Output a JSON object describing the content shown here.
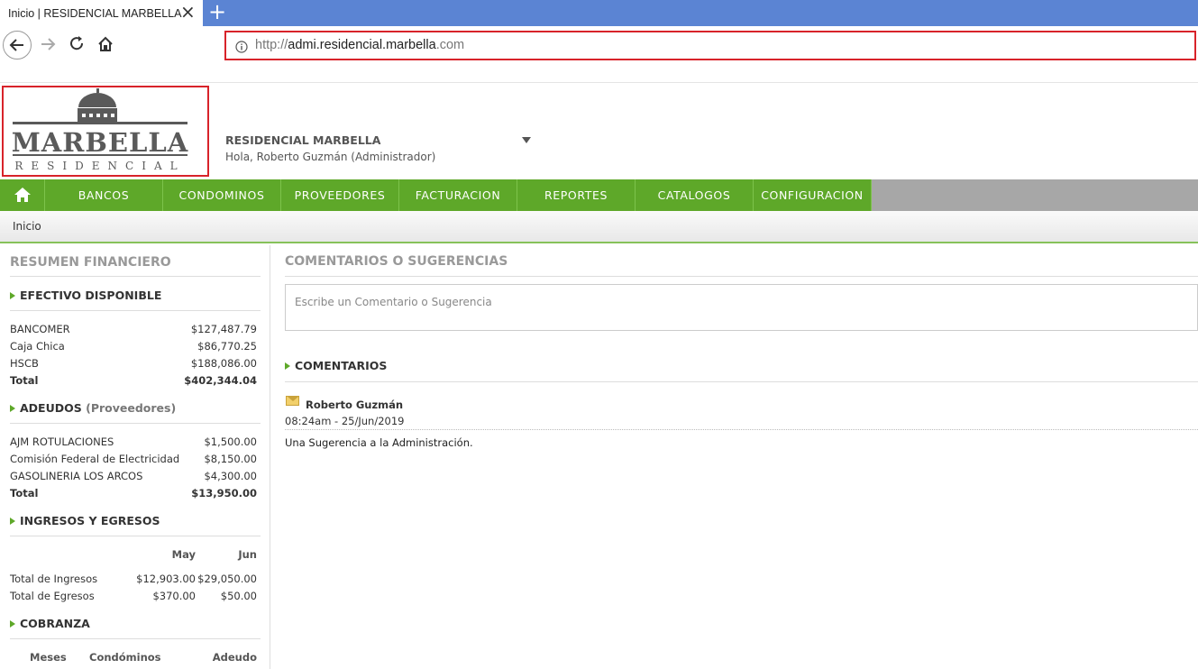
{
  "browser": {
    "tab_title": "Inicio | RESIDENCIAL MARBELLA",
    "close_glyph": "×",
    "newtab_glyph": "+",
    "url_prefix": "http://",
    "url_host": "admi.residencial.marbella",
    "url_suffix": ".com"
  },
  "logo": {
    "line1": "MARBELLA",
    "line2": "RESIDENCIAL"
  },
  "header": {
    "site_name": "RESIDENCIAL MARBELLA",
    "greeting": "Hola, Roberto Guzmán (Administrador)"
  },
  "menu": {
    "items": [
      {
        "label": "BANCOS"
      },
      {
        "label": "CONDOMINOS"
      },
      {
        "label": "PROVEEDORES"
      },
      {
        "label": "FACTURACION"
      },
      {
        "label": "REPORTES"
      },
      {
        "label": "CATALOGOS"
      },
      {
        "label": "CONFIGURACION"
      }
    ]
  },
  "breadcrumb": "Inicio",
  "resumen": {
    "title": "RESUMEN FINANCIERO",
    "efectivo": {
      "title": "EFECTIVO DISPONIBLE",
      "rows": [
        {
          "label": "BANCOMER",
          "value": "$127,487.79"
        },
        {
          "label": "Caja Chica",
          "value": "$86,770.25"
        },
        {
          "label": "HSCB",
          "value": "$188,086.00"
        }
      ],
      "total_label": "Total",
      "total_value": "$402,344.04"
    },
    "adeudos": {
      "title": "ADEUDOS",
      "title_note": "(Proveedores)",
      "rows": [
        {
          "label": "AJM ROTULACIONES",
          "value": "$1,500.00"
        },
        {
          "label": "Comisión Federal de Electricidad",
          "value": "$8,150.00"
        },
        {
          "label": "GASOLINERIA LOS ARCOS",
          "value": "$4,300.00"
        }
      ],
      "total_label": "Total",
      "total_value": "$13,950.00"
    },
    "ingresos": {
      "title": "INGRESOS Y EGRESOS",
      "col1": "May",
      "col2": "Jun",
      "rows": [
        {
          "label": "Total de Ingresos",
          "v1": "$12,903.00",
          "v2": "$29,050.00"
        },
        {
          "label": "Total de Egresos",
          "v1": "$370.00",
          "v2": "$50.00"
        }
      ]
    },
    "cobranza": {
      "title": "COBRANZA",
      "col1": "Meses",
      "col2": "Condóminos",
      "col3": "Adeudo"
    }
  },
  "comentarios": {
    "title": "COMENTARIOS O SUGERENCIAS",
    "placeholder": "Escribe un Comentario o Sugerencia",
    "list_title": "COMENTARIOS",
    "items": [
      {
        "author": "Roberto Guzmán",
        "date": "08:24am - 25/Jun/2019",
        "body": "Una Sugerencia a la Administración."
      }
    ]
  },
  "colors": {
    "accent_green": "#5ea829",
    "highlight_red": "#d8232a",
    "tab_blue": "#5b84d3"
  }
}
